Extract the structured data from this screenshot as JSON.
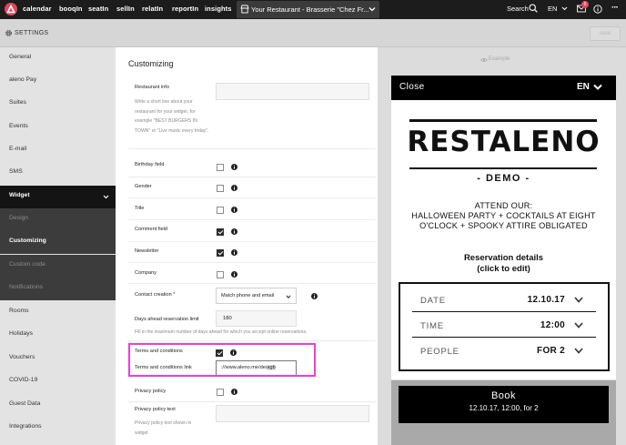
{
  "topnav": {
    "items": [
      "calendar",
      "booqIn",
      "seatIn",
      "sellIn",
      "relatIn",
      "reportIn",
      "insights"
    ],
    "restaurant": "Your Restaurant - Brasserie \"Chez Fr...",
    "search": "Search",
    "language": "EN",
    "mail_badge": "6"
  },
  "settings": {
    "title": "SETTINGS",
    "save_label": "save"
  },
  "sidebar": {
    "items": [
      {
        "label": "General"
      },
      {
        "label": "aleno Pay"
      },
      {
        "label": "Suites"
      },
      {
        "label": "Events"
      },
      {
        "label": "E-mail"
      },
      {
        "label": "SMS"
      },
      {
        "label": "Widget"
      },
      {
        "label": "Design"
      },
      {
        "label": "Customizing"
      },
      {
        "label": "Custom code"
      },
      {
        "label": "Notifications"
      },
      {
        "label": "Rooms"
      },
      {
        "label": "Holidays"
      },
      {
        "label": "Vouchers"
      },
      {
        "label": "COVID-19"
      },
      {
        "label": "Guest Data"
      },
      {
        "label": "Integrations"
      }
    ]
  },
  "form": {
    "title": "Customizing",
    "restaurant_info": {
      "label": "Restaurant info",
      "help": "Write a short line about your restaurant for your widget, for example \"BEST BURGERS IN TOWN\" or \"Live music every friday\"."
    },
    "toggles": [
      {
        "label": "Birthday field",
        "checked": false
      },
      {
        "label": "Gender",
        "checked": false
      },
      {
        "label": "Title",
        "checked": false
      },
      {
        "label": "Comment field",
        "checked": true
      },
      {
        "label": "Newsletter",
        "checked": true
      },
      {
        "label": "Company",
        "checked": false
      }
    ],
    "contact_creation": {
      "label": "Contact creation",
      "required_mark": "*",
      "value": "Match phone and email"
    },
    "days_ahead": {
      "label": "Days ahead reservation limit",
      "value": "180",
      "help": "Fill in the maximum number of days ahead for which you accept online reservations."
    },
    "terms": {
      "label": "Terms and conditions",
      "checked": true,
      "link_label": "Terms and conditions link",
      "link_value": "://www.aleno.me/de/",
      "link_value_tail": "agb"
    },
    "privacy": {
      "label": "Privacy policy",
      "checked": false,
      "text_label": "Privacy policy text",
      "text_help": "Privacy policy text shown in widget"
    },
    "highlight_color": "#ee3ed9"
  },
  "preview": {
    "example": "Example",
    "widget": {
      "close": "Close",
      "language": "EN",
      "brand": "RESTALENO",
      "demo": "- DEMO -",
      "attend_lines": [
        "ATTEND OUR:",
        "HALLOWEEN PARTY + COCKTAILS AT EIGHT",
        "O'CLOCK + SPOOKY ATTIRE OBLIGATED"
      ],
      "resdetails_lines": [
        "Reservation details",
        "(click to edit)"
      ],
      "rows": [
        {
          "key": "DATE",
          "value": "12.10.17"
        },
        {
          "key": "TIME",
          "value": "12:00"
        },
        {
          "key": "PEOPLE",
          "value": "FOR 2"
        }
      ],
      "book": "Book",
      "book_summary": "12.10.17, 12:00, for 2"
    }
  }
}
